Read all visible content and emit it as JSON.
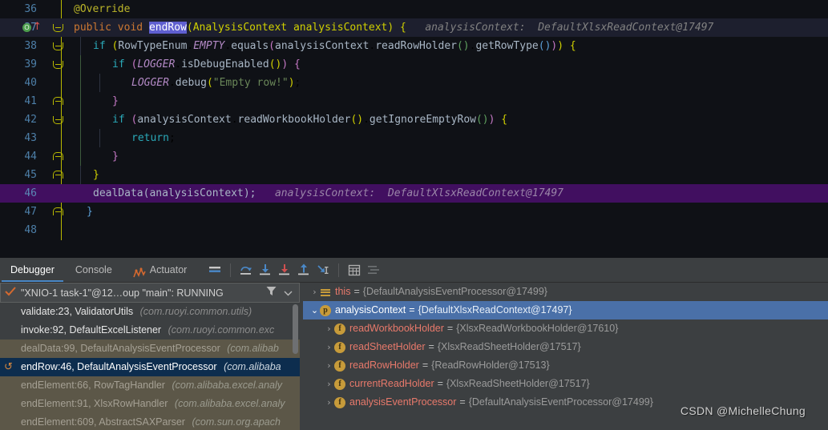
{
  "editor": {
    "lines": [
      {
        "num": "36",
        "indent": 0
      },
      {
        "num": "37",
        "indent": 0
      },
      {
        "num": "38",
        "indent": 0
      },
      {
        "num": "39",
        "indent": 0
      },
      {
        "num": "40",
        "indent": 0
      },
      {
        "num": "41",
        "indent": 0
      },
      {
        "num": "42",
        "indent": 0
      },
      {
        "num": "43",
        "indent": 0
      },
      {
        "num": "44",
        "indent": 0
      },
      {
        "num": "45",
        "indent": 0
      },
      {
        "num": "46",
        "indent": 0
      },
      {
        "num": "47",
        "indent": 0
      },
      {
        "num": "48",
        "indent": 0
      }
    ],
    "code": {
      "l36_annotation": "@Override",
      "l37_modifier_public": "public",
      "l37_modifier_void": "void",
      "l37_method": "endRow",
      "l37_params": "(AnalysisContext analysisContext) {",
      "l37_hint": "analysisContext:  DefaultXlsxReadContext@17497",
      "l38_text": "if (RowTypeEnum.EMPTY.equals(analysisContext.readRowHolder().getRowType())) {",
      "l39_text": "if (LOGGER.isDebugEnabled()) {",
      "l40_text": "LOGGER.debug(\"Empty row!\");",
      "l41_text": "}",
      "l42_text": "if (analysisContext.readWorkbookHolder().getIgnoreEmptyRow()) {",
      "l43_text": "return;",
      "l44_text": "}",
      "l45_text": "}",
      "l46_text": "dealData(analysisContext);",
      "l46_hint": "analysisContext:  DefaultXlsxReadContext@17497",
      "l47_text": "}"
    },
    "gutter": {
      "override_icon": "override-method-icon",
      "override_glyph": "O",
      "override_arrow": "↑"
    }
  },
  "debug": {
    "tabs": [
      {
        "label": "Debugger",
        "active": true,
        "icon": null
      },
      {
        "label": "Console",
        "active": false,
        "icon": null
      },
      {
        "label": "Actuator",
        "active": false,
        "icon": "actuator-icon"
      }
    ],
    "toolbar": [
      {
        "name": "show-execution-point-icon",
        "glyph": "≡"
      },
      {
        "name": "step-over-icon",
        "glyph": "↷"
      },
      {
        "name": "step-into-icon",
        "glyph": "↓"
      },
      {
        "name": "force-step-into-icon",
        "glyph": "↓"
      },
      {
        "name": "step-out-icon",
        "glyph": "↑"
      },
      {
        "name": "run-to-cursor-icon",
        "glyph": "↘"
      },
      {
        "name": "evaluate-expression-icon",
        "glyph": "▦"
      },
      {
        "name": "settings-icon",
        "glyph": "≔"
      }
    ],
    "thread": {
      "status_icon": "running-check-icon",
      "label": "\"XNIO-1 task-1\"@12…oup \"main\": RUNNING",
      "filter_icon": "filter-icon",
      "dropdown_icon": "chevron-down-icon"
    },
    "frames": [
      {
        "method": "validate:23, ValidatorUtils",
        "pkg": "(com.ruoyi.common.utils)",
        "style": "app",
        "current": false
      },
      {
        "method": "invoke:92, DefaultExcelListener",
        "pkg": "(com.ruoyi.common.exc",
        "style": "app",
        "current": false
      },
      {
        "method": "dealData:99, DefaultAnalysisEventProcessor",
        "pkg": "(com.alibab",
        "style": "lib",
        "current": false
      },
      {
        "method": "endRow:46, DefaultAnalysisEventProcessor",
        "pkg": "(com.alibaba",
        "style": "sel",
        "current": true
      },
      {
        "method": "endElement:66, RowTagHandler",
        "pkg": "(com.alibaba.excel.analy",
        "style": "lib",
        "current": false
      },
      {
        "method": "endElement:91, XlsxRowHandler",
        "pkg": "(com.alibaba.excel.analy",
        "style": "lib",
        "current": false
      },
      {
        "method": "endElement:609, AbstractSAXParser",
        "pkg": "(com.sun.org.apach",
        "style": "lib",
        "current": false
      }
    ],
    "frame_reset_icon": "↺",
    "variables": [
      {
        "depth": 0,
        "expanded": false,
        "icon": "lines",
        "icon_letter": "",
        "name": "this",
        "value": "{DefaultAnalysisEventProcessor@17499}",
        "selected": false
      },
      {
        "depth": 0,
        "expanded": true,
        "icon": "circle",
        "icon_letter": "p",
        "name": "analysisContext",
        "value": "{DefaultXlsxReadContext@17497}",
        "selected": true
      },
      {
        "depth": 1,
        "expanded": false,
        "icon": "circle",
        "icon_letter": "f",
        "name": "readWorkbookHolder",
        "value": "{XlsxReadWorkbookHolder@17610}",
        "selected": false
      },
      {
        "depth": 1,
        "expanded": false,
        "icon": "circle",
        "icon_letter": "f",
        "name": "readSheetHolder",
        "value": "{XlsxReadSheetHolder@17517}",
        "selected": false
      },
      {
        "depth": 1,
        "expanded": false,
        "icon": "circle",
        "icon_letter": "f",
        "name": "readRowHolder",
        "value": "{ReadRowHolder@17513}",
        "selected": false
      },
      {
        "depth": 1,
        "expanded": false,
        "icon": "circle",
        "icon_letter": "f",
        "name": "currentReadHolder",
        "value": "{XlsxReadSheetHolder@17517}",
        "selected": false
      },
      {
        "depth": 1,
        "expanded": false,
        "icon": "circle",
        "icon_letter": "f",
        "name": "analysisEventProcessor",
        "value": "{DefaultAnalysisEventProcessor@17499}",
        "selected": false
      }
    ],
    "expand_glyph": "›",
    "collapse_glyph": "⌄",
    "equals": "="
  },
  "watermark": "CSDN @MichelleChung",
  "colors": {
    "editor_bg": "#0f1116",
    "exec_line": "#410f60",
    "selection": "#5f5fd0",
    "accent": "#4a88c7",
    "panel_bg": "#3c3f41",
    "lib_frame": "#5c5748",
    "sel_frame": "#0d2d4e",
    "var_sel": "#4a70a8"
  }
}
